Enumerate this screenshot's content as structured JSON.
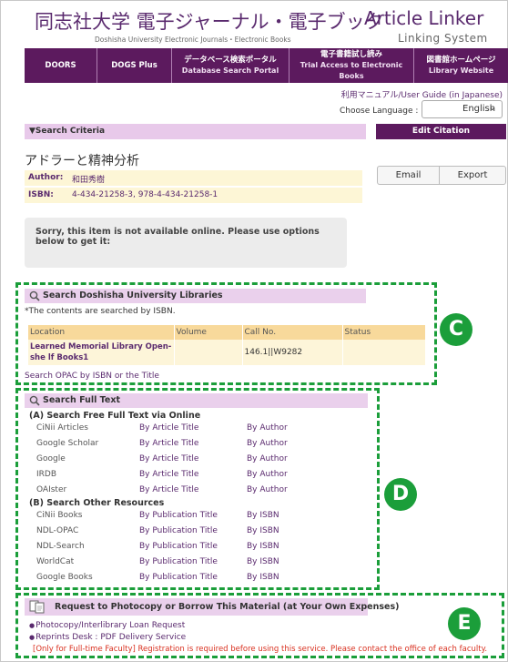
{
  "header": {
    "title_jp": "同志社大学 電子ジャーナル・電子ブック",
    "title_en": "Article Linker",
    "subtitle_jp": "Doshisha University Electronic Journals・Electronic Books",
    "subtitle_en": "Linking System"
  },
  "nav": [
    {
      "label": "DOORS",
      "sub": ""
    },
    {
      "label": "DOGS Plus",
      "sub": ""
    },
    {
      "label": "データベース検索ポータル",
      "sub": "Database Search Portal"
    },
    {
      "label": "電子書籍試し読み",
      "sub": "Trial Access to Electronic Books"
    },
    {
      "label": "図書館ホームページ",
      "sub": "Library Website"
    }
  ],
  "manual_link": "利用マニュアル/User Guide (in Japanese)",
  "language": {
    "label": "Choose Language :",
    "value": "English"
  },
  "criteria": {
    "label": "▼Search Criteria",
    "edit_button": "Edit Citation"
  },
  "item": {
    "title": "アドラーと精神分析",
    "author_label": "Author:",
    "author": "和田秀樹",
    "isbn_label": "ISBN:",
    "isbn": "4-434-21258-3, 978-4-434-21258-1"
  },
  "actions": {
    "email": "Email",
    "export": "Export"
  },
  "notice": "Sorry, this item is not available online. Please use options below to get it:",
  "section_c": {
    "heading": "Search Doshisha University Libraries",
    "note": "*The contents are searched by ISBN.",
    "columns": [
      "Location",
      "Volume",
      "Call No.",
      "Status"
    ],
    "rows": [
      {
        "location": "Learned Memorial Library Open-she lf Books1",
        "volume": "",
        "call_no": "146.1||W9282",
        "status": ""
      }
    ],
    "opac_link": "Search OPAC by ISBN or the Title",
    "badge": "C"
  },
  "section_d": {
    "heading": "Search Full Text",
    "sub_a": "(A)  Search Free Full Text via Online",
    "online": [
      {
        "source": "CiNii Articles",
        "link1": "By Article Title",
        "link2": "By Author"
      },
      {
        "source": "Google Scholar",
        "link1": "By Article Title",
        "link2": "By Author"
      },
      {
        "source": "Google",
        "link1": "By Article Title",
        "link2": "By Author"
      },
      {
        "source": "IRDB",
        "link1": "By Article Title",
        "link2": "By Author"
      },
      {
        "source": "OAIster",
        "link1": "By Article Title",
        "link2": "By Author"
      }
    ],
    "sub_b": "(B)  Search Other Resources",
    "other": [
      {
        "source": "CiNii Books",
        "link1": "By Publication Title",
        "link2": "By ISBN"
      },
      {
        "source": "NDL-OPAC",
        "link1": "By Publication Title",
        "link2": "By ISBN"
      },
      {
        "source": "NDL-Search",
        "link1": "By Publication Title",
        "link2": "By ISBN"
      },
      {
        "source": "WorldCat",
        "link1": "By Publication Title",
        "link2": "By ISBN"
      },
      {
        "source": "Google Books",
        "link1": "By Publication Title",
        "link2": "By ISBN"
      }
    ],
    "badge": "D"
  },
  "section_e": {
    "heading": "Request to Photocopy or Borrow This Material (at Your Own Expenses)",
    "link1": "Photocopy/Interlibrary Loan Request",
    "link2": "Reprints Desk : PDF Delivery Service",
    "note": "[Only for Full-time Faculty] Registration is required before using this service. Please contact the office of each faculty.",
    "badge": "E"
  }
}
